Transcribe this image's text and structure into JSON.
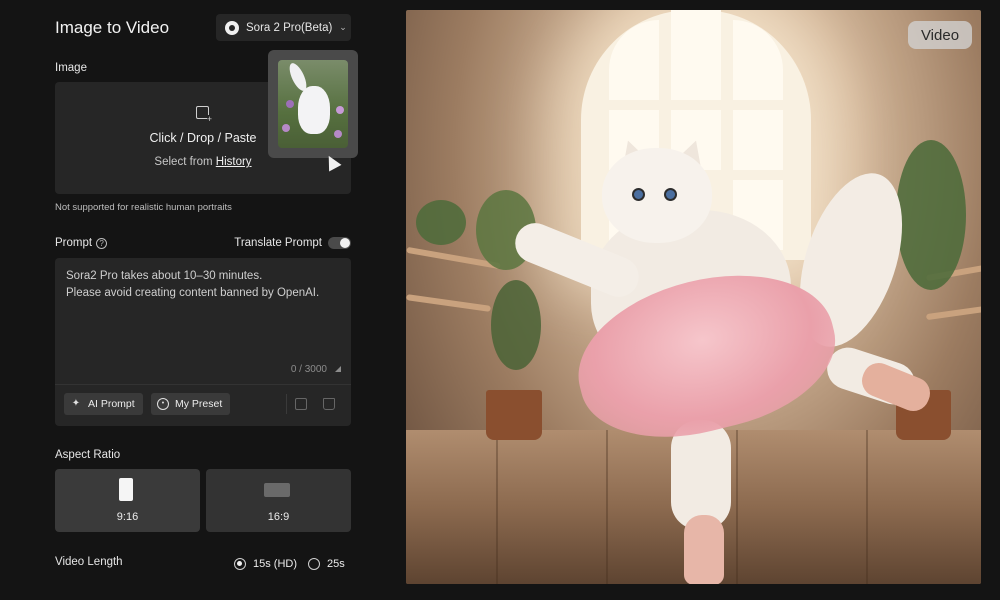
{
  "panel": {
    "title": "Image to Video",
    "model": "Sora 2 Pro(Beta)",
    "image_label": "Image",
    "upload_text": "Click / Drop / Paste",
    "history_prefix": "Select from ",
    "history_link": "History",
    "note": "Not supported for realistic human portraits",
    "prompt_label": "Prompt",
    "translate_label": "Translate Prompt",
    "translate_enabled": false,
    "prompt_text": "Sora2 Pro takes about 10–30 minutes.\nPlease avoid creating content banned by OpenAI.",
    "counter": "0 / 3000",
    "ai_prompt_label": "AI Prompt",
    "my_preset_label": "My Preset",
    "aspect_label": "Aspect Ratio",
    "ratios": [
      {
        "label": "9:16",
        "selected": true
      },
      {
        "label": "16:9",
        "selected": false
      }
    ],
    "length_label": "Video Length",
    "lengths": [
      {
        "label": "15s (HD)",
        "selected": true
      },
      {
        "label": "25s",
        "selected": false
      }
    ]
  },
  "preview": {
    "badge": "Video"
  },
  "icons": {
    "model_logo": "openai-logo-icon",
    "upload": "image-upload-icon",
    "help": "help-icon",
    "ai_prompt": "magic-wand-icon",
    "preset": "lightbulb-icon",
    "save": "save-icon",
    "delete": "trash-icon"
  }
}
